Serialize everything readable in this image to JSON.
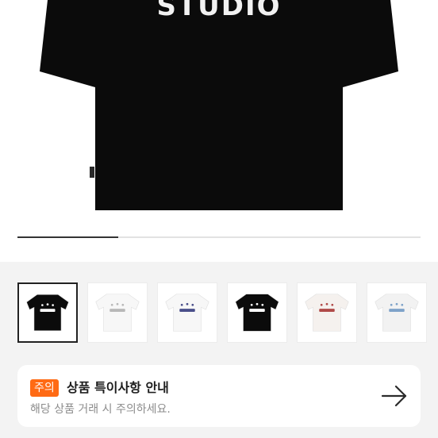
{
  "hero": {
    "logo_text": "STUDIO",
    "shirt_color": "#0b0b0b",
    "gallery_progress": 0.25
  },
  "thumbnails": [
    {
      "color": "#0b0b0b",
      "print": "#ffffff",
      "selected": true
    },
    {
      "color": "#f7f7f7",
      "print": "#b8b8b8",
      "selected": false
    },
    {
      "color": "#f7f7f7",
      "print": "#4a4f8a",
      "selected": false
    },
    {
      "color": "#0b0b0b",
      "print": "#ffffff",
      "selected": false
    },
    {
      "color": "#f5f1ee",
      "print": "#b04a48",
      "selected": false
    },
    {
      "color": "#f2f2f2",
      "print": "#7ea2c9",
      "selected": false
    }
  ],
  "notice": {
    "badge": "주의",
    "title": "상품 특이사항 안내",
    "subtitle": "해당 상품 거래 시 주의하세요.",
    "badge_color": "#ff6a14"
  }
}
